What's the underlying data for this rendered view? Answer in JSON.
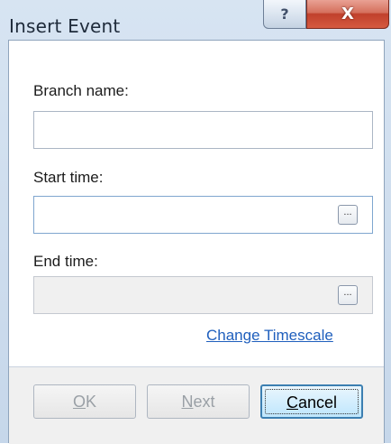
{
  "window": {
    "title": "Insert Event",
    "help_glyph": "?",
    "close_glyph": "X"
  },
  "form": {
    "branch_name_label": "Branch name:",
    "branch_name_value": "",
    "start_time_label": "Start time:",
    "start_time_value": "",
    "end_time_label": "End time:",
    "end_time_value": "",
    "browse_label": "...",
    "change_timescale_link": "Change Timescale"
  },
  "buttons": {
    "ok": {
      "mnemonic": "O",
      "rest": "K",
      "enabled": false
    },
    "next": {
      "mnemonic": "N",
      "rest": "ext",
      "enabled": false
    },
    "cancel": {
      "mnemonic": "C",
      "rest": "ancel",
      "enabled": true
    }
  },
  "colors": {
    "link": "#1f5fbd",
    "close_button": "#c0402c",
    "default_button_border": "#3c7fb1"
  },
  "icons": {
    "help": "question-mark-icon",
    "close": "close-x-icon"
  }
}
